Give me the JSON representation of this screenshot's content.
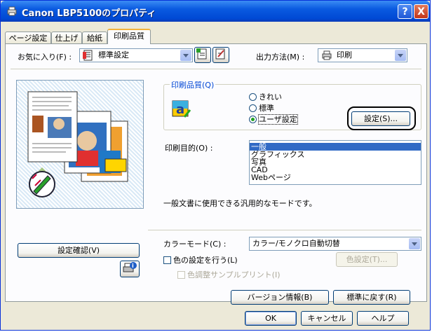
{
  "window": {
    "title": "Canon LBP5100のプロパティ",
    "help_btn": "?",
    "close_btn": "X"
  },
  "tabs": [
    {
      "label": "ページ設定"
    },
    {
      "label": "仕上げ"
    },
    {
      "label": "給紙"
    },
    {
      "label": "印刷品質"
    }
  ],
  "favorites": {
    "label": "お気に入り(F) :",
    "value": "標準設定"
  },
  "output": {
    "label": "出力方法(M) :",
    "value": "印刷"
  },
  "print_quality": {
    "group_label": "印刷品質(Q)",
    "options": [
      {
        "label": "きれい",
        "selected": false
      },
      {
        "label": "標準",
        "selected": false
      },
      {
        "label": "ユーザ設定",
        "selected": true
      }
    ],
    "settings_btn": "設定(S)..."
  },
  "purpose": {
    "label": "印刷目的(O) :",
    "items": [
      {
        "label": "一般",
        "selected": true
      },
      {
        "label": "グラフィックス",
        "selected": false
      },
      {
        "label": "写真",
        "selected": false
      },
      {
        "label": "CAD",
        "selected": false
      },
      {
        "label": "Webページ",
        "selected": false
      }
    ],
    "description": "一般文書に使用できる汎用的なモードです。"
  },
  "color_mode": {
    "label": "カラーモード(C) :",
    "value": "カラー/モノクロ自動切替"
  },
  "color_settings": {
    "check_label": "色の設定を行う(L)",
    "btn": "色設定(T)...",
    "sample_label": "色調整サンプルプリント(I)"
  },
  "left": {
    "confirm_btn": "設定確認(V)"
  },
  "bottom": {
    "version_btn": "バージョン情報(B)",
    "defaults_btn": "標準に戻す(R)",
    "ok": "OK",
    "cancel": "キャンセル",
    "help": "ヘルプ"
  },
  "colors": {
    "title_bar": "#0a5ae0",
    "list_selection": "#316ac5",
    "group_title": "#0046d5"
  }
}
